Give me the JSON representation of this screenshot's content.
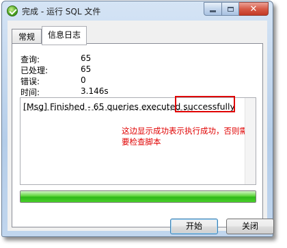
{
  "window": {
    "title": "完成 - 运行 SQL 文件"
  },
  "tabs": [
    {
      "label": "常规"
    },
    {
      "label": "信息日志"
    }
  ],
  "stats": [
    {
      "label": "查询:",
      "value": "65"
    },
    {
      "label": "已处理:",
      "value": "65"
    },
    {
      "label": "错误:",
      "value": "0"
    },
    {
      "label": "时间:",
      "value": "3.146s"
    }
  ],
  "log": {
    "line": "[Msg] Finished - 65 queries executed successfully",
    "separator": "------------------------------------------------------"
  },
  "annotation": "这边显示成功表示执行成功，否则需要检查脚本",
  "progress": {
    "fraction": 1.0,
    "color": "#2eb81a"
  },
  "buttons": {
    "start": "开始",
    "close": "关闭"
  },
  "colors": {
    "annotation": "#e00000"
  }
}
